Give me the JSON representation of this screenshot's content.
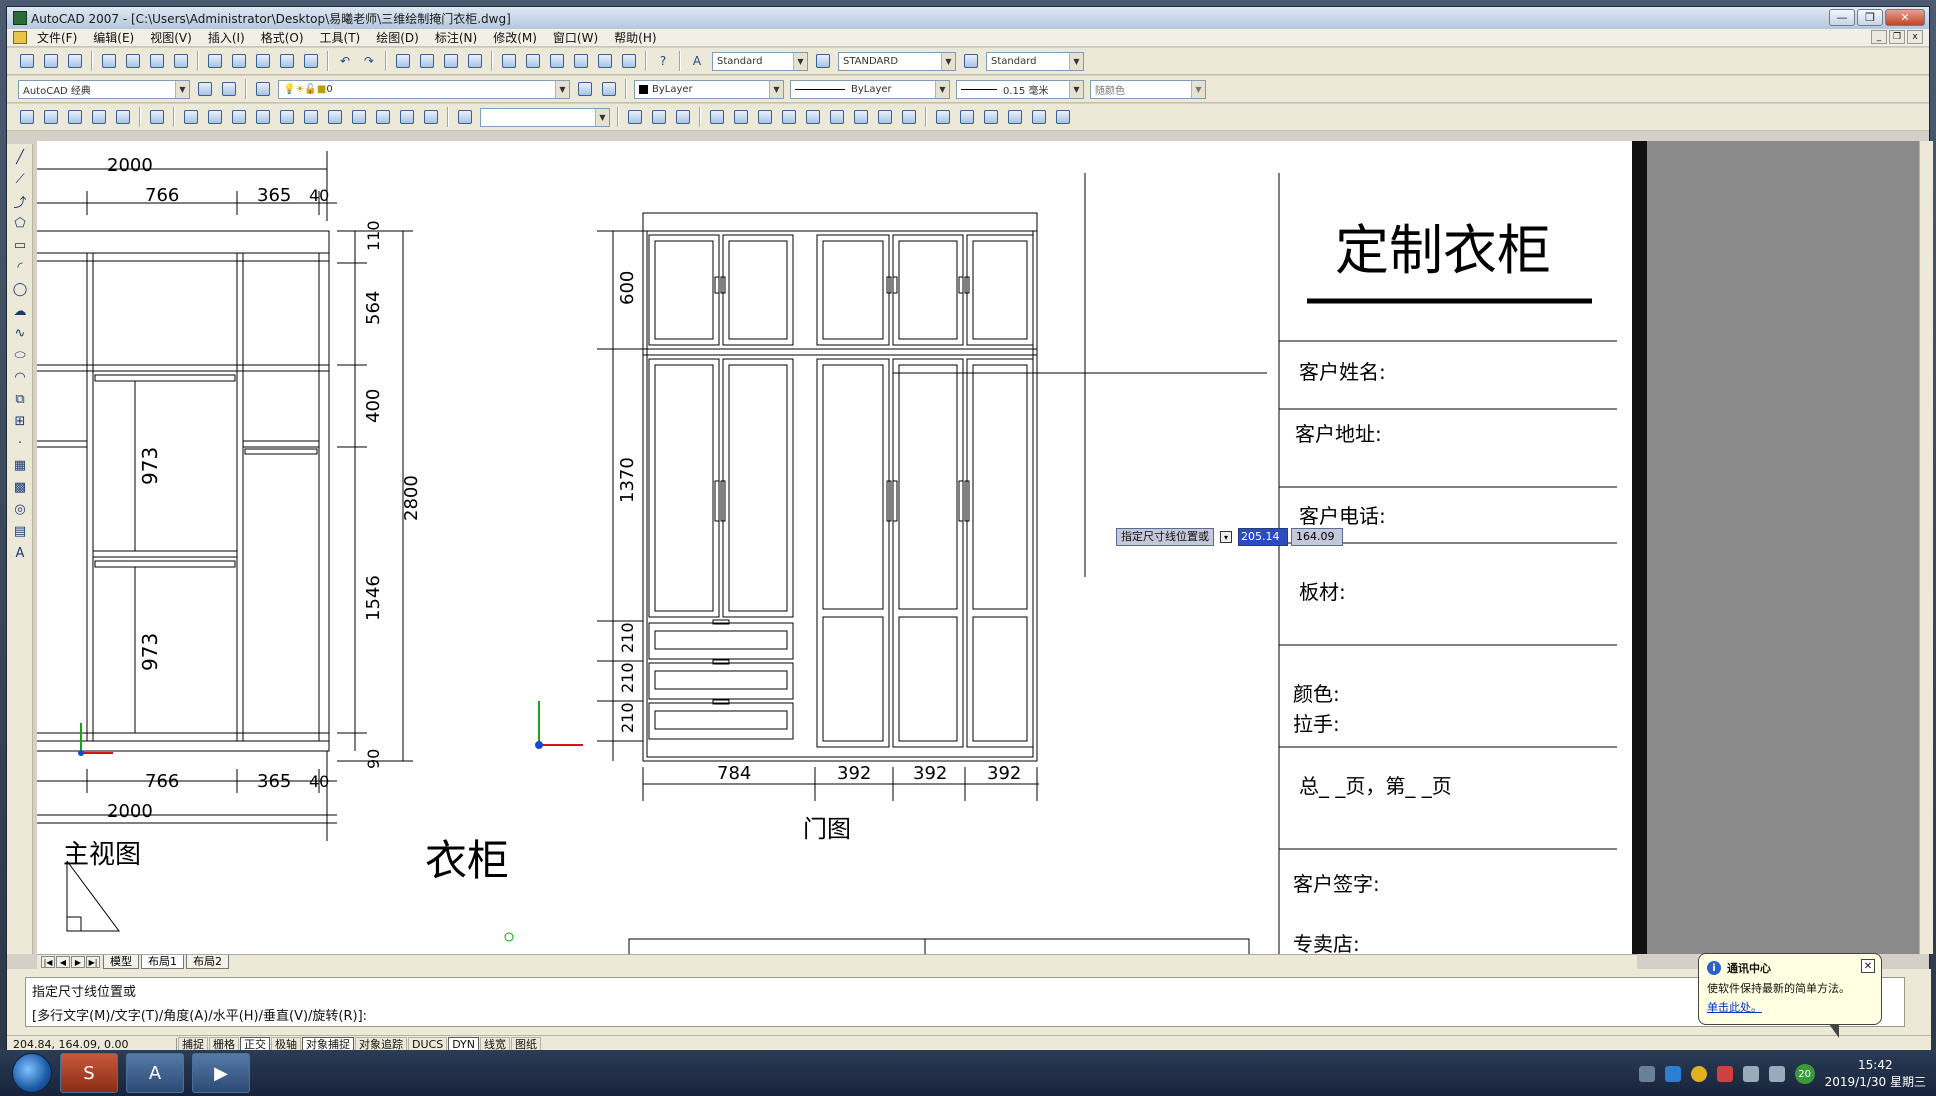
{
  "window": {
    "title": "AutoCAD 2007 - [C:\\Users\\Administrator\\Desktop\\易曦老师\\三维绘制掩门衣柜.dwg]",
    "buttons": {
      "min": "—",
      "max": "❐",
      "close": "✕"
    }
  },
  "menu": [
    "文件(F)",
    "编辑(E)",
    "视图(V)",
    "插入(I)",
    "格式(O)",
    "工具(T)",
    "绘图(D)",
    "标注(N)",
    "修改(M)",
    "窗口(W)",
    "帮助(H)"
  ],
  "toolbar": {
    "text_style": "Standard",
    "dim_style": "STANDARD",
    "table_style": "Standard",
    "workspace": "AutoCAD 经典",
    "layer": "0",
    "color": "ByLayer",
    "linetype": "ByLayer",
    "lineweight": "0.15 毫米",
    "plotstyle": "随颜色"
  },
  "drawing": {
    "main_view": {
      "dims": [
        "2000",
        "766",
        "365",
        "40",
        "110",
        "564",
        "400",
        "973",
        "973",
        "1546",
        "2800",
        "90",
        "766",
        "365",
        "40",
        "2000"
      ],
      "label": "主视图"
    },
    "wardrobe_label": "衣柜",
    "door_view": {
      "dims_left": [
        "600",
        "1370",
        "210",
        "210",
        "210"
      ],
      "dims_bottom": [
        "784",
        "392",
        "392",
        "392"
      ],
      "label": "门图"
    },
    "title_block": {
      "title": "定制衣柜",
      "fields": [
        "客户姓名:",
        "客户地址:",
        "客户电话:",
        "板材:",
        "颜色:",
        "拉手:",
        "总_ _页，第_ _页",
        "客户签字:",
        "专卖店:"
      ]
    },
    "dyn_input": {
      "prompt": "指定尺寸线位置或",
      "value1": "205.14",
      "value2": "164.09"
    }
  },
  "tabs": [
    "模型",
    "布局1",
    "布局2"
  ],
  "command": {
    "line1": "指定尺寸线位置或",
    "line2": "[多行文字(M)/文字(T)/角度(A)/水平(H)/垂直(V)/旋转(R)]:"
  },
  "status": {
    "coords": "204.84, 164.09, 0.00",
    "buttons": [
      "捕捉",
      "栅格",
      "正交",
      "极轴",
      "对象捕捉",
      "对象追踪",
      "DUCS",
      "DYN",
      "线宽",
      "图纸"
    ]
  },
  "notification": {
    "title": "通讯中心",
    "body": "使软件保持最新的简单方法。",
    "link": "单击此处。"
  },
  "taskbar": {
    "time": "15:42",
    "date": "2019/1/30 星期三",
    "badge": "20"
  }
}
